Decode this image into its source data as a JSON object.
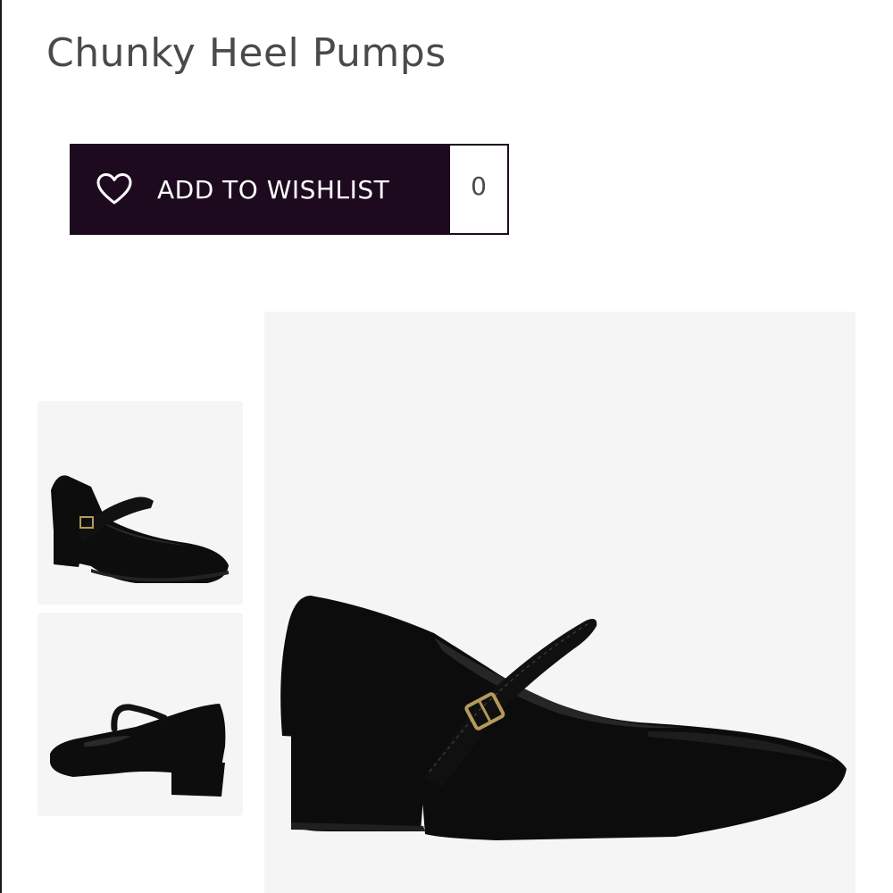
{
  "product": {
    "title": "Chunky Heel Pumps"
  },
  "wishlist": {
    "label": "ADD TO WISHLIST",
    "count": "0",
    "icon": "heart-outline-icon",
    "button_color": "#1e0a1e"
  },
  "gallery": {
    "thumbnails": [
      {
        "description": "front three-quarter view"
      },
      {
        "description": "rear three-quarter view"
      }
    ],
    "main_image": {
      "description": "side profile view"
    }
  },
  "colors": {
    "image_background": "#f5f5f5",
    "title_text": "#4a4a4a",
    "shoe": "#0c0c0c",
    "buckle": "#b49a5a"
  }
}
